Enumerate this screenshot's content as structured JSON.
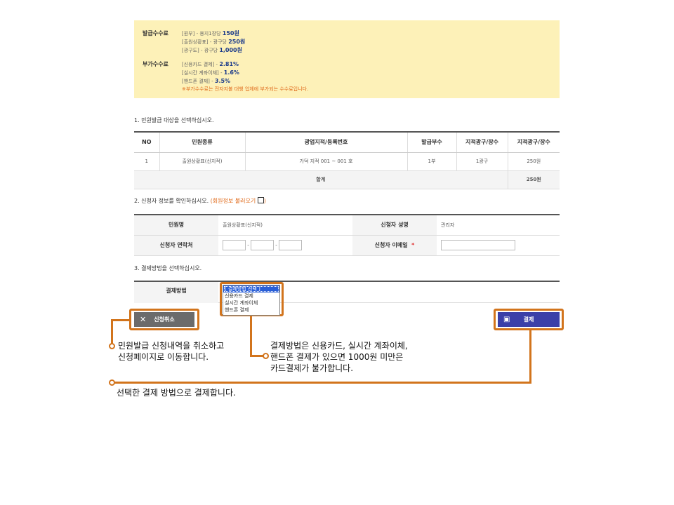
{
  "fees": {
    "issue_label": "발급수수료",
    "issue_lines": [
      {
        "text": "[원부] - 용지1장당 ",
        "amount": "150원"
      },
      {
        "text": "[출원상황표] - 광구당 ",
        "amount": "250원"
      },
      {
        "text": "[광구도] - 광구당 ",
        "amount": "1,000원"
      }
    ],
    "extra_label": "부가수수료",
    "extra_lines": [
      {
        "text": "[신용카드 결제] - ",
        "amount": "2.81%"
      },
      {
        "text": "[실시간 계좌이체] - ",
        "amount": "1.6%"
      },
      {
        "text": "[핸드폰 결제] - ",
        "amount": "3.5%"
      }
    ],
    "extra_note": "※부가수수료는 전자지불 대행 업체에 부가되는 수수료입니다."
  },
  "section1": {
    "title": "1. 민원발급 대상을 선택하십시오."
  },
  "table1": {
    "headers": [
      "NO",
      "민원종류",
      "광업지적/등록번호",
      "발급부수",
      "지적광구/장수",
      "지적광구/장수"
    ],
    "row": [
      "1",
      "출원상황표(신지적)",
      "가덕 지적 001 ~ 001 호",
      "1부",
      "1광구",
      "250원"
    ],
    "sum_label": "합계",
    "sum_value": "250원"
  },
  "section2": {
    "title": "2. 신청자 정보를 확인하십시오.",
    "link": "(회원정보 불러오기",
    "link_end": ")"
  },
  "applicant": {
    "civil_label": "민원명",
    "civil_value": "출원상황표(신지적)",
    "name_label": "신청자 성명",
    "name_value": "관리자",
    "phone_label": "신청자 연락처",
    "phone_sep": "-",
    "email_label": "신청자 이메일",
    "required_mark": "*"
  },
  "section3": {
    "title": "3. 결제방법을 선택하십시오."
  },
  "payment": {
    "label": "결제방법",
    "options": [
      "[ 결제방법 선택 ]",
      "신용카드 결제",
      "실시간 계좌이체",
      "핸드폰 결제"
    ]
  },
  "buttons": {
    "cancel": "신청취소",
    "pay": "결제"
  },
  "callouts": {
    "cancel": [
      "민원발급 신청내역을 취소하고",
      "신청페이지로 이동합니다."
    ],
    "method": [
      "결제방법은 신용카드, 실시간 계좌이체,",
      "핸드폰 결제가 있으면 1000원 미만은",
      "카드결제가 불가합니다."
    ],
    "pay": [
      "선택한 결제 방법으로 결제합니다."
    ]
  },
  "colors": {
    "accent": "#d2741c",
    "fee_bg": "#fdf1b8",
    "pay_button": "#3b3fa8",
    "cancel_button": "#6b6b6b",
    "highlight": "#1a3a8a"
  }
}
